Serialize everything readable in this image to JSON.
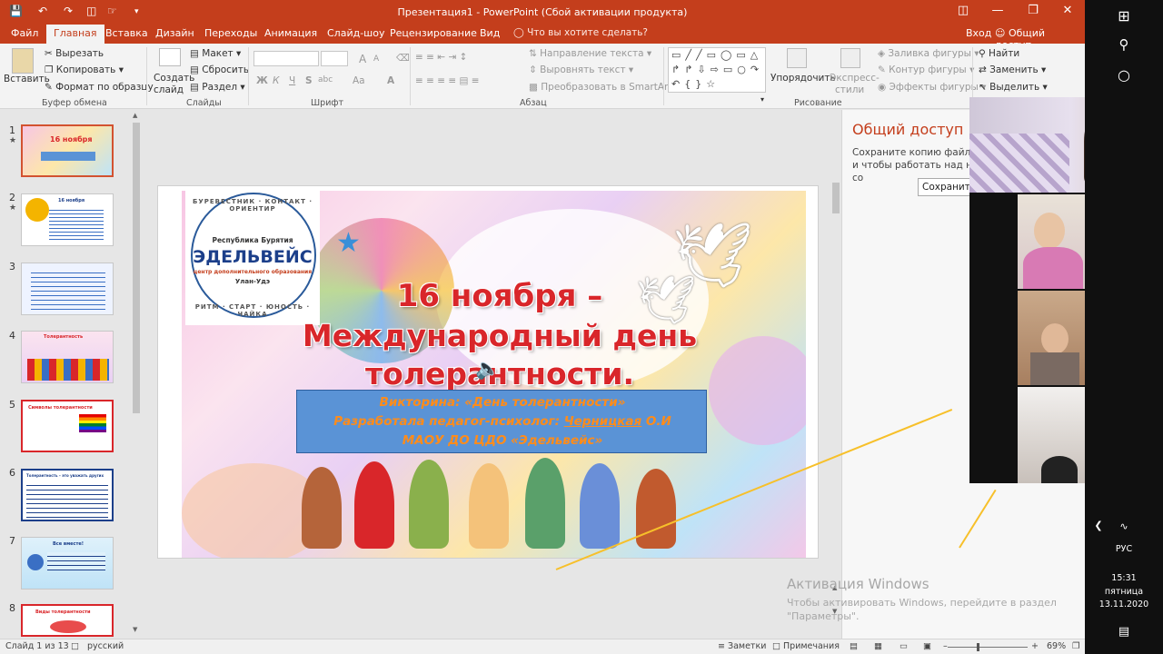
{
  "app": {
    "title": "Презентация1 - PowerPoint (Сбой активации продукта)"
  },
  "tabs": [
    "Файл",
    "Главная",
    "Вставка",
    "Дизайн",
    "Переходы",
    "Анимация",
    "Слайд-шоу",
    "Рецензирование",
    "Вид"
  ],
  "tellme": "Что вы хотите сделать?",
  "account": {
    "signin": "Вход",
    "share": "Общий доступ"
  },
  "ribbon": {
    "clipboard": {
      "paste": "Вставить",
      "cut": "Вырезать",
      "copy": "Копировать",
      "format_painter": "Формат по образцу",
      "label": "Буфер обмена"
    },
    "slides": {
      "new_slide_1": "Создать",
      "new_slide_2": "слайд",
      "layout": "Макет",
      "reset": "Сбросить",
      "section": "Раздел",
      "label": "Слайды"
    },
    "font": {
      "bold": "Ж",
      "italic": "К",
      "underline": "Ч",
      "strike": "S",
      "shadow": "abc",
      "case": "Аа",
      "color": "А",
      "grow": "A",
      "shrink": "A",
      "label": "Шрифт"
    },
    "paragraph": {
      "text_direction": "Направление текста",
      "align_text": "Выровнять текст",
      "smartart": "Преобразовать в SmartArt",
      "label": "Абзац"
    },
    "drawing": {
      "arrange": "Упорядочить",
      "quick_styles_1": "Экспресс-",
      "quick_styles_2": "стили",
      "fill": "Заливка фигуры",
      "outline": "Контур фигуры",
      "effects": "Эффекты фигуры",
      "label": "Рисование"
    },
    "editing": {
      "find": "Найти",
      "replace": "Заменить",
      "select": "Выделить"
    }
  },
  "thumbnails": {
    "items": [
      {
        "num": "1",
        "star": "★",
        "title": "16 ноября"
      },
      {
        "num": "2",
        "star": "★",
        "title": "16 ноября"
      },
      {
        "num": "3",
        "star": "",
        "title": ""
      },
      {
        "num": "4",
        "star": "",
        "title": "Толерантность"
      },
      {
        "num": "5",
        "star": "",
        "title": "Символы толерантности"
      },
      {
        "num": "6",
        "star": "",
        "title": "Толерантность – это уважать других"
      },
      {
        "num": "7",
        "star": "",
        "title": "Все вместе!"
      },
      {
        "num": "8",
        "star": "",
        "title": "Виды толерантности"
      }
    ]
  },
  "slide": {
    "logo": {
      "top": "БУРЕВЕСТНИК · КОНТАКТ · ОРИЕНТИР",
      "region": "Республика Бурятия",
      "name": "ЭДЕЛЬВЕЙС",
      "sub": "центр дополнительного образования",
      "city": "Улан-Удэ",
      "bottom": "РИТМ · СТАРТ · ЮНОСТЬ · ЧАЙКА"
    },
    "heading_1": "16 ноября –",
    "heading_2": "Международный день",
    "heading_3": "толерантности.",
    "box_line1": "Викторина: «День толерантности»",
    "box_line2_a": "Разработала педагог-психолог: ",
    "box_line2_b": "Черницкая",
    "box_line2_c": " О.И",
    "box_line3": "МАОУ ДО ЦДО «Эдельвейс»"
  },
  "sharepane": {
    "title": "Общий доступ",
    "text": "Сохраните копию файла в и чтобы работать над ним со",
    "button": "Сохранить"
  },
  "activation": {
    "line1": "Активация Windows",
    "line2": "Чтобы активировать Windows, перейдите в раздел",
    "line3": "\"Параметры\"."
  },
  "status": {
    "slide_info": "Слайд 1 из 13",
    "language": "русский",
    "notes": "Заметки",
    "comments": "Примечания",
    "zoom": "69%"
  },
  "taskbar": {
    "lang": "РУС",
    "time": "15:31",
    "day": "пятница",
    "date": "13.11.2020"
  },
  "colors": {
    "accent": "#c43e1c",
    "selected_thumb": "#d35230",
    "heading_red": "#d9262a",
    "box_blue": "#5a93d6",
    "box_text": "#ff8c1a"
  }
}
